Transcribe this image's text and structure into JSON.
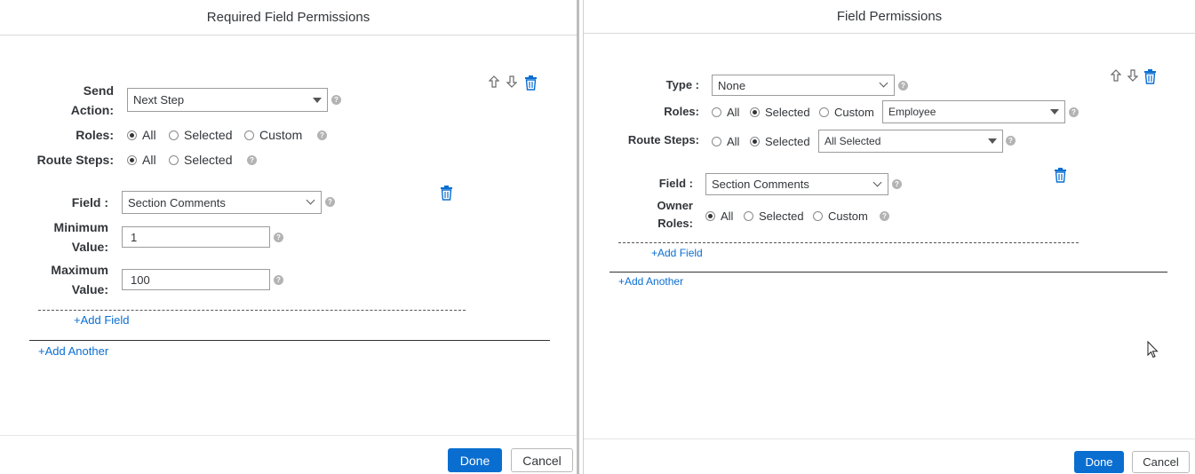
{
  "left": {
    "title": "Required Field Permissions",
    "send_action": {
      "label_line1": "Send",
      "label_line2": "Action:",
      "value": "Next Step"
    },
    "roles": {
      "label": "Roles:",
      "options": [
        "All",
        "Selected",
        "Custom"
      ],
      "selected": "All"
    },
    "route_steps": {
      "label": "Route Steps:",
      "options": [
        "All",
        "Selected"
      ],
      "selected": "All"
    },
    "field": {
      "label": "Field :",
      "value": "Section Comments"
    },
    "min_value": {
      "label_line1": "Minimum",
      "label_line2": "Value:",
      "value": "1"
    },
    "max_value": {
      "label_line1": "Maximum",
      "label_line2": "Value:",
      "value": "100"
    },
    "add_field": "+Add Field",
    "add_another": "+Add Another",
    "done": "Done",
    "cancel": "Cancel"
  },
  "right": {
    "title": "Field Permissions",
    "type": {
      "label": "Type :",
      "value": "None"
    },
    "roles": {
      "label": "Roles:",
      "options": [
        "All",
        "Selected",
        "Custom"
      ],
      "selected": "Selected",
      "value": "Employee"
    },
    "route_steps": {
      "label": "Route Steps:",
      "options": [
        "All",
        "Selected"
      ],
      "selected": "Selected",
      "value": "All Selected"
    },
    "field": {
      "label": "Field :",
      "value": "Section Comments"
    },
    "owner_roles": {
      "label_line1": "Owner",
      "label_line2": "Roles:",
      "options": [
        "All",
        "Selected",
        "Custom"
      ],
      "selected": "All"
    },
    "add_field": "+Add Field",
    "add_another": "+Add Another",
    "done": "Done",
    "cancel": "Cancel"
  },
  "icons": {
    "help": "help-icon",
    "move_up": "arrow-up-icon",
    "move_down": "arrow-down-icon",
    "delete": "trash-icon",
    "cursor": "mouse-cursor-icon"
  },
  "colors": {
    "accent": "#0a6ed1",
    "link": "#0a6ed1",
    "help_icon": "#b3b3b3",
    "text": "#32363a"
  }
}
